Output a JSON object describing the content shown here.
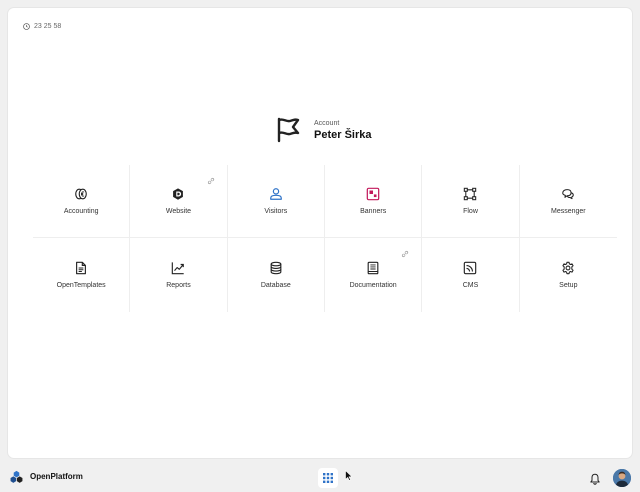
{
  "clock": {
    "time": "23 25 58",
    "icon": "clock-icon"
  },
  "account": {
    "caption": "Account",
    "name": "Peter Širka",
    "icon": "flag-icon"
  },
  "apps": [
    {
      "label": "Accounting",
      "icon": "accounting-icon",
      "color": "#222222",
      "external": false
    },
    {
      "label": "Website",
      "icon": "website-icon",
      "color": "#222222",
      "external": true
    },
    {
      "label": "Visitors",
      "icon": "visitors-icon",
      "color": "#2f73c8",
      "external": false
    },
    {
      "label": "Banners",
      "icon": "banners-icon",
      "color": "#c2185b",
      "external": false
    },
    {
      "label": "Flow",
      "icon": "flow-icon",
      "color": "#222222",
      "external": false
    },
    {
      "label": "Messenger",
      "icon": "messenger-icon",
      "color": "#222222",
      "external": false
    },
    {
      "label": "OpenTemplates",
      "icon": "templates-icon",
      "color": "#222222",
      "external": false
    },
    {
      "label": "Reports",
      "icon": "reports-icon",
      "color": "#222222",
      "external": false
    },
    {
      "label": "Database",
      "icon": "database-icon",
      "color": "#222222",
      "external": false
    },
    {
      "label": "Documentation",
      "icon": "documentation-icon",
      "color": "#222222",
      "external": true
    },
    {
      "label": "CMS",
      "icon": "cms-icon",
      "color": "#222222",
      "external": false
    },
    {
      "label": "Setup",
      "icon": "gear-icon",
      "color": "#222222",
      "external": false
    }
  ],
  "taskbar": {
    "brand": "OpenPlatform",
    "brand_icon": "openplatform-logo",
    "launcher_icon": "grid-icon",
    "launcher_color": "#2f73c8",
    "notifications_icon": "bell-icon",
    "avatar": "user-avatar"
  }
}
